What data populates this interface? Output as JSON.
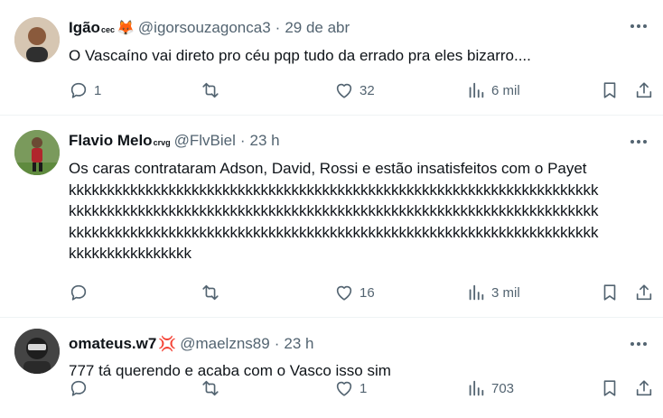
{
  "tweets": [
    {
      "name": "Igão",
      "name_sup": "cec",
      "emoji": "🦊",
      "handle": "@igorsouzagonca3",
      "dot": "·",
      "time": "29 de abr",
      "text": "O Vascaíno vai direto pro céu pqp tudo da errado pra eles bizarro....",
      "replies": "1",
      "retweets": "",
      "likes": "32",
      "views": "6 mil"
    },
    {
      "name": "Flavio Melo",
      "name_sup": "crvg",
      "emoji": "",
      "handle": "@FlvBiel",
      "dot": "·",
      "time": "23 h",
      "text": "Os caras contrataram Adson, David, Rossi e estão insatisfeitos com o Payet\nkkkkkkkkkkkkkkkkkkkkkkkkkkkkkkkkkkkkkkkkkkkkkkkkkkkkkkkkkkkkkkkkkkkkk\nkkkkkkkkkkkkkkkkkkkkkkkkkkkkkkkkkkkkkkkkkkkkkkkkkkkkkkkkkkkkkkkkkkkkk\nkkkkkkkkkkkkkkkkkkkkkkkkkkkkkkkkkkkkkkkkkkkkkkkkkkkkkkkkkkkkkkkkkkkkk\nkkkkkkkkkkkkkkkk",
      "replies": "",
      "retweets": "",
      "likes": "16",
      "views": "3 mil"
    },
    {
      "name": "omateus.w7",
      "name_sup": "",
      "emoji": "💢",
      "handle": "@maelzns89",
      "dot": "·",
      "time": "23 h",
      "text": "777 tá querendo e acaba com o Vasco isso sim",
      "replies": "",
      "retweets": "",
      "likes": "1",
      "views": "703"
    }
  ],
  "icons": {
    "reply": "reply-icon",
    "retweet": "retweet-icon",
    "like": "heart-icon",
    "views": "views-icon",
    "bookmark": "bookmark-icon",
    "share": "share-icon",
    "more": "more-icon"
  },
  "colors": {
    "text": "#0f1419",
    "secondary": "#536471",
    "divider": "#eff3f4"
  }
}
